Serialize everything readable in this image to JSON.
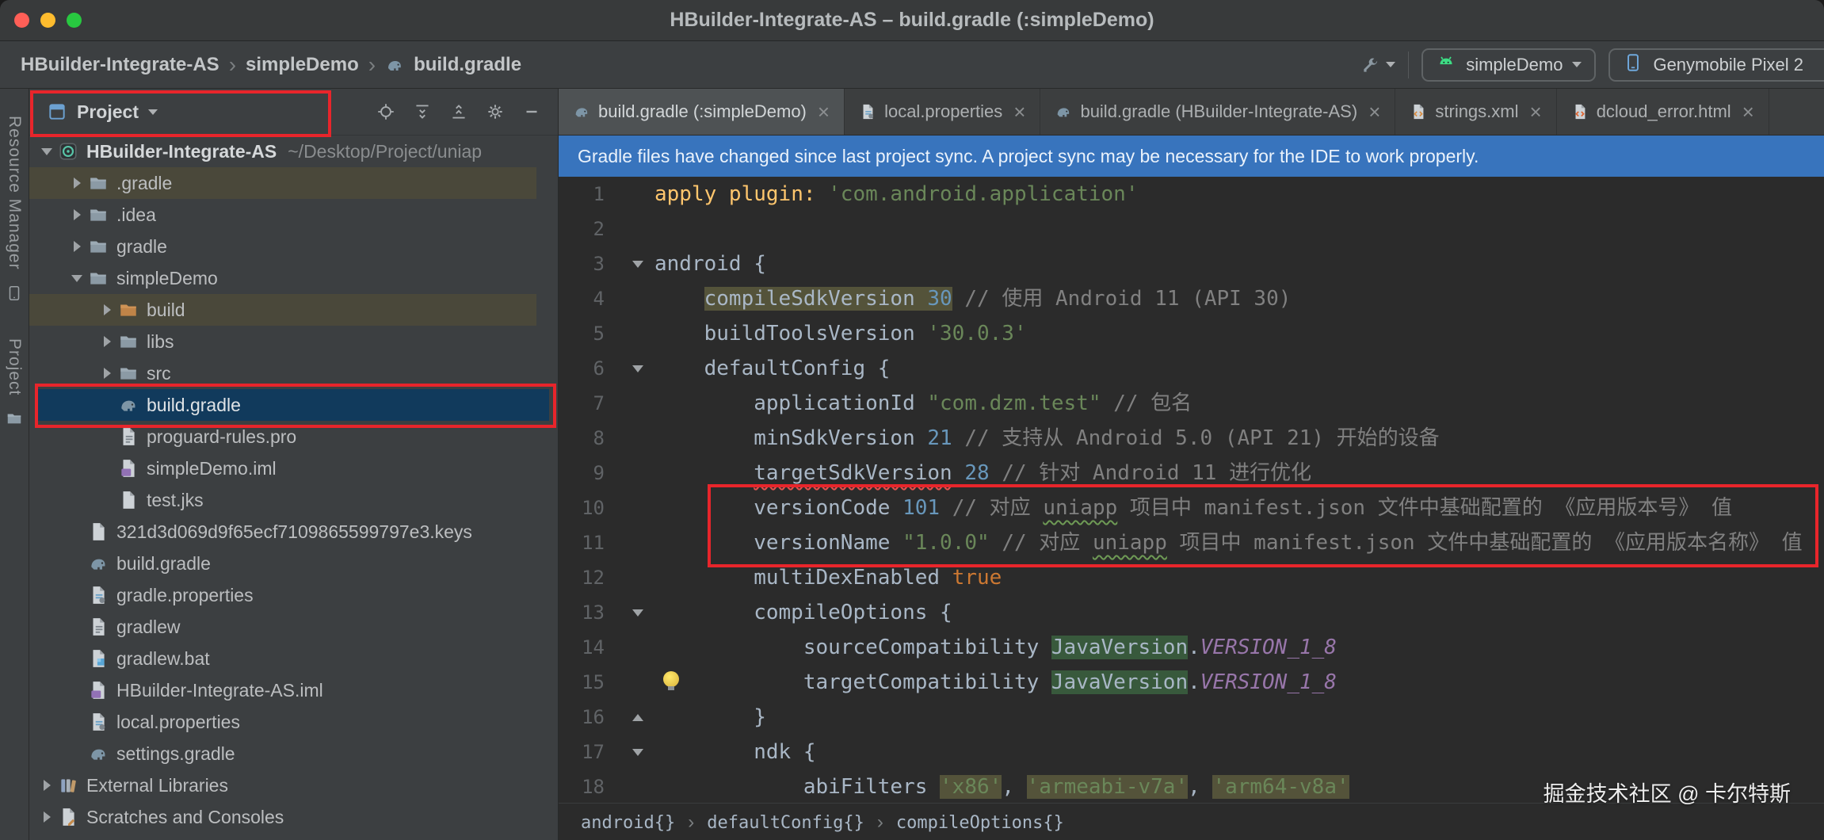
{
  "window": {
    "title": "HBuilder-Integrate-AS – build.gradle (:simpleDemo)"
  },
  "navbar": {
    "breadcrumbs": [
      "HBuilder-Integrate-AS",
      "simpleDemo",
      "build.gradle"
    ],
    "run_config": {
      "module": "simpleDemo",
      "device": "Genymobile Pixel 2"
    }
  },
  "left_stripe": {
    "items": [
      {
        "label": "Resource Manager",
        "icon": "device"
      },
      {
        "label": "Project",
        "icon": "folder"
      }
    ]
  },
  "project_panel": {
    "header": {
      "title": "Project",
      "view_icon": "project-view",
      "toolbar_icons": [
        "locate",
        "expand-all",
        "collapse-all",
        "settings-gear",
        "hide"
      ]
    },
    "tree": [
      {
        "label": "HBuilder-Integrate-AS",
        "suffix": "~/Desktop/Project/uniap",
        "depth": 0,
        "icon": "android-studio-project",
        "expand": "expanded",
        "bold": true
      },
      {
        "label": ".gradle",
        "depth": 1,
        "icon": "folder",
        "expand": "collapsed",
        "highlight": "olive"
      },
      {
        "label": ".idea",
        "depth": 1,
        "icon": "folder",
        "expand": "collapsed"
      },
      {
        "label": "gradle",
        "depth": 1,
        "icon": "folder",
        "expand": "collapsed"
      },
      {
        "label": "simpleDemo",
        "depth": 1,
        "icon": "folder",
        "expand": "expanded"
      },
      {
        "label": "build",
        "depth": 2,
        "icon": "folder-build",
        "expand": "collapsed",
        "highlight": "olive"
      },
      {
        "label": "libs",
        "depth": 2,
        "icon": "folder",
        "expand": "collapsed"
      },
      {
        "label": "src",
        "depth": 2,
        "icon": "folder",
        "expand": "collapsed"
      },
      {
        "label": "build.gradle",
        "depth": 2,
        "icon": "gradle-file",
        "selected": true
      },
      {
        "label": "proguard-rules.pro",
        "depth": 2,
        "icon": "text-file"
      },
      {
        "label": "simpleDemo.iml",
        "depth": 2,
        "icon": "iml-file"
      },
      {
        "label": "test.jks",
        "depth": 2,
        "icon": "plain-file"
      },
      {
        "label": "321d3d069d9f65ecf7109865599797e3.keys",
        "depth": 1,
        "icon": "plain-file"
      },
      {
        "label": "build.gradle",
        "depth": 1,
        "icon": "gradle-file"
      },
      {
        "label": "gradle.properties",
        "depth": 1,
        "icon": "properties-file"
      },
      {
        "label": "gradlew",
        "depth": 1,
        "icon": "text-file"
      },
      {
        "label": "gradlew.bat",
        "depth": 1,
        "icon": "bat-file"
      },
      {
        "label": "HBuilder-Integrate-AS.iml",
        "depth": 1,
        "icon": "iml-file"
      },
      {
        "label": "local.properties",
        "depth": 1,
        "icon": "properties-file"
      },
      {
        "label": "settings.gradle",
        "depth": 1,
        "icon": "gradle-file"
      },
      {
        "label": "External Libraries",
        "depth": 0,
        "icon": "library",
        "expand": "collapsed"
      },
      {
        "label": "Scratches and Consoles",
        "depth": 0,
        "icon": "scratch",
        "expand": "collapsed"
      }
    ]
  },
  "editor": {
    "tabs": [
      {
        "label": "build.gradle (:simpleDemo)",
        "icon": "gradle-file",
        "active": true
      },
      {
        "label": "local.properties",
        "icon": "properties-file"
      },
      {
        "label": "build.gradle (HBuilder-Integrate-AS)",
        "icon": "gradle-file"
      },
      {
        "label": "strings.xml",
        "icon": "xml-file"
      },
      {
        "label": "dcloud_error.html",
        "icon": "html-file"
      }
    ],
    "banner": {
      "text": "Gradle files have changed since last project sync. A project sync may be necessary for the IDE to work properly."
    },
    "code": {
      "lines": [
        {
          "n": 1,
          "segs": [
            {
              "t": "apply ",
              "c": "m"
            },
            {
              "t": "plugin: ",
              "c": "m"
            },
            {
              "t": "'com.android.application'",
              "c": "str"
            }
          ]
        },
        {
          "n": 2,
          "segs": []
        },
        {
          "n": 3,
          "fold": "down",
          "segs": [
            {
              "t": "android {",
              "c": "pl"
            }
          ]
        },
        {
          "n": 4,
          "segs": [
            {
              "t": "    ",
              "c": "pl"
            },
            {
              "t": "compileSdkVersion ",
              "c": "pl",
              "hl": "olive"
            },
            {
              "t": "30",
              "c": "num",
              "hl": "olive"
            },
            {
              "t": " ",
              "c": "pl"
            },
            {
              "t": "// 使用 Android 11 (API 30)",
              "c": "cmt"
            }
          ]
        },
        {
          "n": 5,
          "segs": [
            {
              "t": "    buildToolsVersion ",
              "c": "pl"
            },
            {
              "t": "'30.0.3'",
              "c": "str"
            }
          ]
        },
        {
          "n": 6,
          "fold": "down",
          "segs": [
            {
              "t": "    defaultConfig {",
              "c": "pl"
            }
          ]
        },
        {
          "n": 7,
          "segs": [
            {
              "t": "        applicationId ",
              "c": "pl"
            },
            {
              "t": "\"com.dzm.test\"",
              "c": "str"
            },
            {
              "t": " ",
              "c": "pl"
            },
            {
              "t": "// 包名",
              "c": "cmt"
            }
          ]
        },
        {
          "n": 8,
          "segs": [
            {
              "t": "        minSdkVersion ",
              "c": "pl"
            },
            {
              "t": "21",
              "c": "num"
            },
            {
              "t": " ",
              "c": "pl"
            },
            {
              "t": "// 支持从 Android 5.0 (API 21) 开始的设备",
              "c": "cmt"
            }
          ]
        },
        {
          "n": 9,
          "segs": [
            {
              "t": "        ",
              "c": "pl"
            },
            {
              "t": "targetSdkVersion",
              "c": "pl",
              "wavy": "red"
            },
            {
              "t": " ",
              "c": "pl"
            },
            {
              "t": "28",
              "c": "num"
            },
            {
              "t": " ",
              "c": "pl"
            },
            {
              "t": "// 针对 Android 11 进行优化",
              "c": "cmt"
            }
          ]
        },
        {
          "n": 10,
          "segs": [
            {
              "t": "        versionCode ",
              "c": "pl"
            },
            {
              "t": "101",
              "c": "num"
            },
            {
              "t": " ",
              "c": "pl"
            },
            {
              "t": "// 对应 ",
              "c": "cmt"
            },
            {
              "t": "uniapp",
              "c": "cmt",
              "wavy": "green"
            },
            {
              "t": " 项目中 manifest.json 文件中基础配置的 《应用版本号》 值",
              "c": "cmt"
            }
          ]
        },
        {
          "n": 11,
          "segs": [
            {
              "t": "        versionName ",
              "c": "pl"
            },
            {
              "t": "\"1.0.0\"",
              "c": "str"
            },
            {
              "t": " ",
              "c": "pl"
            },
            {
              "t": "// 对应 ",
              "c": "cmt"
            },
            {
              "t": "uniapp",
              "c": "cmt",
              "wavy": "green"
            },
            {
              "t": " 项目中 manifest.json 文件中基础配置的 《应用版本名称》 值",
              "c": "cmt"
            }
          ]
        },
        {
          "n": 12,
          "segs": [
            {
              "t": "        multiDexEnabled ",
              "c": "pl"
            },
            {
              "t": "true",
              "c": "kw"
            }
          ]
        },
        {
          "n": 13,
          "fold": "down",
          "segs": [
            {
              "t": "        compileOptions {",
              "c": "pl"
            }
          ]
        },
        {
          "n": 14,
          "segs": [
            {
              "t": "            sourceCompatibility ",
              "c": "pl"
            },
            {
              "t": "JavaVersion",
              "c": "pl",
              "hl": "green"
            },
            {
              "t": ".",
              "c": "pl"
            },
            {
              "t": "VERSION_1_8",
              "c": "const"
            }
          ]
        },
        {
          "n": 15,
          "bulb": true,
          "segs": [
            {
              "t": "            targetCompatibility ",
              "c": "pl"
            },
            {
              "t": "JavaVersion",
              "c": "pl",
              "hl": "green"
            },
            {
              "t": ".",
              "c": "pl"
            },
            {
              "t": "VERSION_1_8",
              "c": "const"
            }
          ]
        },
        {
          "n": 16,
          "fold": "up",
          "segs": [
            {
              "t": "        }",
              "c": "pl"
            }
          ]
        },
        {
          "n": 17,
          "fold": "down",
          "segs": [
            {
              "t": "        ndk {",
              "c": "pl"
            }
          ]
        },
        {
          "n": 18,
          "segs": [
            {
              "t": "            abiFilters ",
              "c": "pl"
            },
            {
              "t": "'x86'",
              "c": "str",
              "hl": "olive"
            },
            {
              "t": ", ",
              "c": "pl"
            },
            {
              "t": "'armeabi-v7a'",
              "c": "str",
              "hl": "olive"
            },
            {
              "t": ", ",
              "c": "pl"
            },
            {
              "t": "'arm64-v8a'",
              "c": "str",
              "hl": "olive"
            }
          ]
        }
      ]
    },
    "breadcrumbs": [
      "android{}",
      "defaultConfig{}",
      "compileOptions{}"
    ]
  },
  "watermark": "掘金技术社区 @ 卡尔特斯",
  "colors": {
    "titlebar_bg": "#383a3b",
    "panel_bg": "#3c3f41",
    "editor_bg": "#2b2b2b",
    "banner_bg": "#3874bd",
    "banner_fg": "#eaf2fb",
    "selection_bg": "#113a5c",
    "olive_row_bg": "#4a483a",
    "tab_active_bg": "#4e5254",
    "annotation": "#e8252b",
    "hl_olive": "#54533a",
    "hl_green": "#38593c",
    "syn_plain": "#a9b7c6",
    "syn_method": "#ffc66d",
    "syn_keyword": "#cc7832",
    "syn_string": "#6a8759",
    "syn_number": "#6897bb",
    "syn_comment": "#808080",
    "syn_constant": "#9876aa",
    "error_wave": "#e4534f",
    "typo_wave": "#6e9a55",
    "stripe_text": "#9a9ea1",
    "tl_red": "#ff5f57",
    "tl_yellow": "#febc2e",
    "tl_green": "#28c840"
  }
}
